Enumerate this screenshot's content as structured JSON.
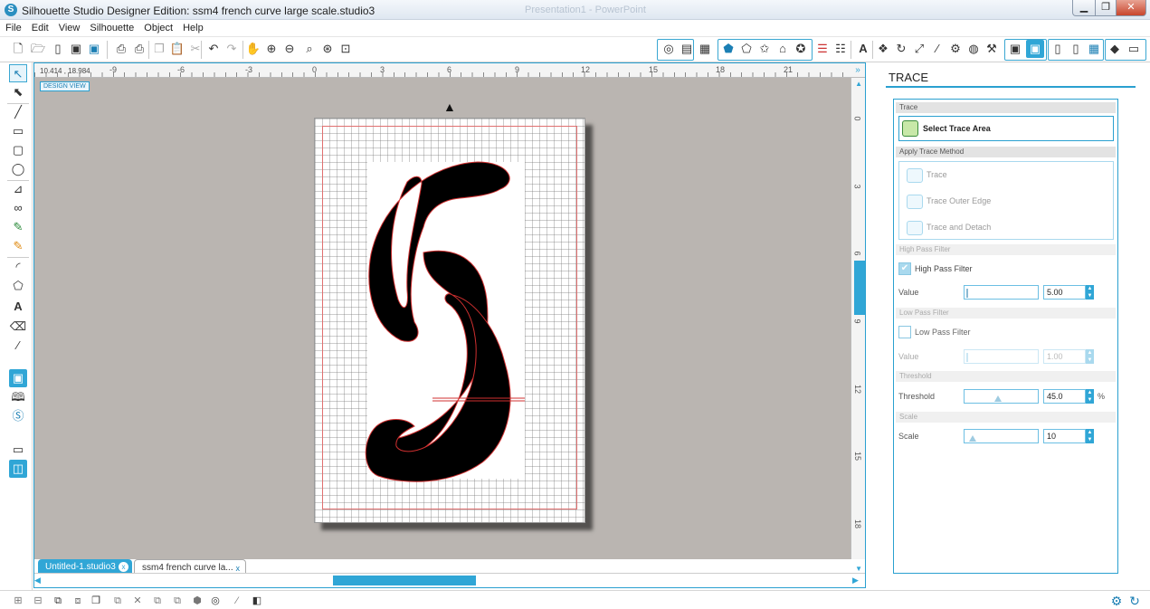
{
  "window": {
    "title": "Silhouette Studio Designer Edition: ssm4 french curve large scale.studio3",
    "app_icon": "S",
    "min": "▁",
    "max": "❐",
    "close": "✕",
    "ghost_title": "Presentation1 - PowerPoint"
  },
  "menu": [
    "File",
    "Edit",
    "View",
    "Silhouette",
    "Object",
    "Help"
  ],
  "toolbar_icons": [
    "new-icon",
    "open-icon",
    "open-library-icon",
    "save-icon",
    "save-library-icon",
    "print-icon",
    "print-cut-icon",
    "copy-icon",
    "paste-icon",
    "cut-icon",
    "undo-icon",
    "redo-icon",
    "pan-icon",
    "zoom-in-icon",
    "zoom-out-icon",
    "zoom-select-icon",
    "zoom-drag-icon",
    "fit-page-icon",
    "fill-icon",
    "line-color-icon",
    "gradient-icon",
    "pattern-icon",
    "star-shape-icon",
    "replicate-icon",
    "offset-icon",
    "line-style-icon",
    "text-icon",
    "transform-icon",
    "rotate-icon",
    "scale-icon",
    "move-icon",
    "align-icon",
    "weld-icon",
    "knife-icon",
    "image-effects-icon",
    "trace-icon",
    "page-setup-icon",
    "cut-settings-icon",
    "send-to-silhouette-icon",
    "grid-icon",
    "eraser-icon",
    "library-icon"
  ],
  "ruler": {
    "coord": "10.414 , 18.984",
    "h_ticks": [
      "-9",
      "-6",
      "-3",
      "0",
      "3",
      "6",
      "9",
      "12",
      "15",
      "18",
      "21"
    ],
    "v_ticks": [
      "0",
      "3",
      "6",
      "9",
      "12",
      "15",
      "18"
    ]
  },
  "design_view": "DESIGN VIEW",
  "tabs": [
    {
      "label": "Untitled-1.studio3",
      "close": "x"
    },
    {
      "label": "ssm4 french curve la...",
      "close": "x"
    }
  ],
  "panel": {
    "title": "TRACE",
    "trace_section": "Trace",
    "select_trace_area": "Select Trace Area",
    "apply_method_section": "Apply Trace Method",
    "methods": [
      "Trace",
      "Trace Outer Edge",
      "Trace and Detach"
    ],
    "high_pass_section": "High Pass Filter",
    "high_pass_label": "High Pass Filter",
    "high_pass_checked": true,
    "high_pass_value_label": "Value",
    "high_pass_value": "5.00",
    "low_pass_section": "Low Pass Filter",
    "low_pass_label": "Low Pass Filter",
    "low_pass_checked": false,
    "low_pass_value_label": "Value",
    "low_pass_value": "1.00",
    "threshold_section": "Threshold",
    "threshold_label": "Threshold",
    "threshold_value": "45.0",
    "threshold_unit": "%",
    "scale_section": "Scale",
    "scale_label": "Scale",
    "scale_value": "10"
  },
  "colors": {
    "accent": "#2aa0d0",
    "design_bg": "#bab5b1",
    "cut_line": "#e03030"
  }
}
